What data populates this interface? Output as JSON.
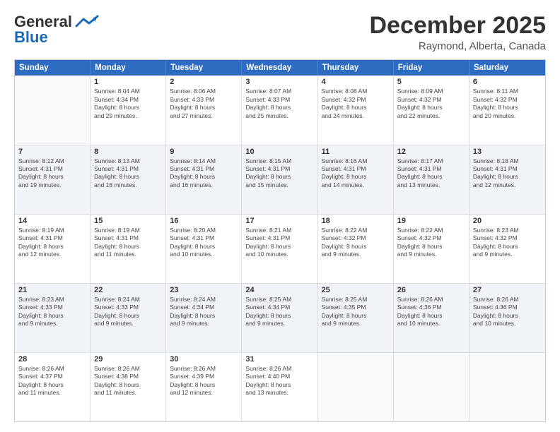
{
  "header": {
    "logo_line1": "General",
    "logo_line2": "Blue",
    "month": "December 2025",
    "location": "Raymond, Alberta, Canada"
  },
  "weekdays": [
    "Sunday",
    "Monday",
    "Tuesday",
    "Wednesday",
    "Thursday",
    "Friday",
    "Saturday"
  ],
  "rows": [
    [
      {
        "day": "",
        "lines": []
      },
      {
        "day": "1",
        "lines": [
          "Sunrise: 8:04 AM",
          "Sunset: 4:34 PM",
          "Daylight: 8 hours",
          "and 29 minutes."
        ]
      },
      {
        "day": "2",
        "lines": [
          "Sunrise: 8:06 AM",
          "Sunset: 4:33 PM",
          "Daylight: 8 hours",
          "and 27 minutes."
        ]
      },
      {
        "day": "3",
        "lines": [
          "Sunrise: 8:07 AM",
          "Sunset: 4:33 PM",
          "Daylight: 8 hours",
          "and 25 minutes."
        ]
      },
      {
        "day": "4",
        "lines": [
          "Sunrise: 8:08 AM",
          "Sunset: 4:32 PM",
          "Daylight: 8 hours",
          "and 24 minutes."
        ]
      },
      {
        "day": "5",
        "lines": [
          "Sunrise: 8:09 AM",
          "Sunset: 4:32 PM",
          "Daylight: 8 hours",
          "and 22 minutes."
        ]
      },
      {
        "day": "6",
        "lines": [
          "Sunrise: 8:11 AM",
          "Sunset: 4:32 PM",
          "Daylight: 8 hours",
          "and 20 minutes."
        ]
      }
    ],
    [
      {
        "day": "7",
        "lines": [
          "Sunrise: 8:12 AM",
          "Sunset: 4:31 PM",
          "Daylight: 8 hours",
          "and 19 minutes."
        ]
      },
      {
        "day": "8",
        "lines": [
          "Sunrise: 8:13 AM",
          "Sunset: 4:31 PM",
          "Daylight: 8 hours",
          "and 18 minutes."
        ]
      },
      {
        "day": "9",
        "lines": [
          "Sunrise: 8:14 AM",
          "Sunset: 4:31 PM",
          "Daylight: 8 hours",
          "and 16 minutes."
        ]
      },
      {
        "day": "10",
        "lines": [
          "Sunrise: 8:15 AM",
          "Sunset: 4:31 PM",
          "Daylight: 8 hours",
          "and 15 minutes."
        ]
      },
      {
        "day": "11",
        "lines": [
          "Sunrise: 8:16 AM",
          "Sunset: 4:31 PM",
          "Daylight: 8 hours",
          "and 14 minutes."
        ]
      },
      {
        "day": "12",
        "lines": [
          "Sunrise: 8:17 AM",
          "Sunset: 4:31 PM",
          "Daylight: 8 hours",
          "and 13 minutes."
        ]
      },
      {
        "day": "13",
        "lines": [
          "Sunrise: 8:18 AM",
          "Sunset: 4:31 PM",
          "Daylight: 8 hours",
          "and 12 minutes."
        ]
      }
    ],
    [
      {
        "day": "14",
        "lines": [
          "Sunrise: 8:19 AM",
          "Sunset: 4:31 PM",
          "Daylight: 8 hours",
          "and 12 minutes."
        ]
      },
      {
        "day": "15",
        "lines": [
          "Sunrise: 8:19 AM",
          "Sunset: 4:31 PM",
          "Daylight: 8 hours",
          "and 11 minutes."
        ]
      },
      {
        "day": "16",
        "lines": [
          "Sunrise: 8:20 AM",
          "Sunset: 4:31 PM",
          "Daylight: 8 hours",
          "and 10 minutes."
        ]
      },
      {
        "day": "17",
        "lines": [
          "Sunrise: 8:21 AM",
          "Sunset: 4:31 PM",
          "Daylight: 8 hours",
          "and 10 minutes."
        ]
      },
      {
        "day": "18",
        "lines": [
          "Sunrise: 8:22 AM",
          "Sunset: 4:32 PM",
          "Daylight: 8 hours",
          "and 9 minutes."
        ]
      },
      {
        "day": "19",
        "lines": [
          "Sunrise: 8:22 AM",
          "Sunset: 4:32 PM",
          "Daylight: 8 hours",
          "and 9 minutes."
        ]
      },
      {
        "day": "20",
        "lines": [
          "Sunrise: 8:23 AM",
          "Sunset: 4:32 PM",
          "Daylight: 8 hours",
          "and 9 minutes."
        ]
      }
    ],
    [
      {
        "day": "21",
        "lines": [
          "Sunrise: 8:23 AM",
          "Sunset: 4:33 PM",
          "Daylight: 8 hours",
          "and 9 minutes."
        ]
      },
      {
        "day": "22",
        "lines": [
          "Sunrise: 8:24 AM",
          "Sunset: 4:33 PM",
          "Daylight: 8 hours",
          "and 9 minutes."
        ]
      },
      {
        "day": "23",
        "lines": [
          "Sunrise: 8:24 AM",
          "Sunset: 4:34 PM",
          "Daylight: 8 hours",
          "and 9 minutes."
        ]
      },
      {
        "day": "24",
        "lines": [
          "Sunrise: 8:25 AM",
          "Sunset: 4:34 PM",
          "Daylight: 8 hours",
          "and 9 minutes."
        ]
      },
      {
        "day": "25",
        "lines": [
          "Sunrise: 8:25 AM",
          "Sunset: 4:35 PM",
          "Daylight: 8 hours",
          "and 9 minutes."
        ]
      },
      {
        "day": "26",
        "lines": [
          "Sunrise: 8:26 AM",
          "Sunset: 4:36 PM",
          "Daylight: 8 hours",
          "and 10 minutes."
        ]
      },
      {
        "day": "27",
        "lines": [
          "Sunrise: 8:26 AM",
          "Sunset: 4:36 PM",
          "Daylight: 8 hours",
          "and 10 minutes."
        ]
      }
    ],
    [
      {
        "day": "28",
        "lines": [
          "Sunrise: 8:26 AM",
          "Sunset: 4:37 PM",
          "Daylight: 8 hours",
          "and 11 minutes."
        ]
      },
      {
        "day": "29",
        "lines": [
          "Sunrise: 8:26 AM",
          "Sunset: 4:38 PM",
          "Daylight: 8 hours",
          "and 11 minutes."
        ]
      },
      {
        "day": "30",
        "lines": [
          "Sunrise: 8:26 AM",
          "Sunset: 4:39 PM",
          "Daylight: 8 hours",
          "and 12 minutes."
        ]
      },
      {
        "day": "31",
        "lines": [
          "Sunrise: 8:26 AM",
          "Sunset: 4:40 PM",
          "Daylight: 8 hours",
          "and 13 minutes."
        ]
      },
      {
        "day": "",
        "lines": []
      },
      {
        "day": "",
        "lines": []
      },
      {
        "day": "",
        "lines": []
      }
    ]
  ]
}
